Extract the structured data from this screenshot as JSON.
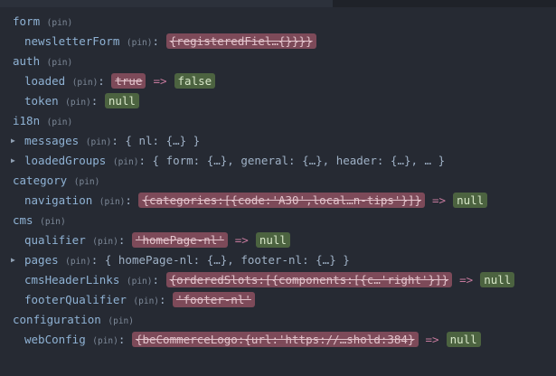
{
  "tree": [
    {
      "type": "section",
      "key": "form",
      "pin": "(pin)"
    },
    {
      "type": "changed",
      "key": "newsletterForm",
      "pin": "(pin)",
      "colon": ":",
      "old": "{registeredFiel…{}}}}"
    },
    {
      "type": "section",
      "key": "auth",
      "pin": "(pin)"
    },
    {
      "type": "changed",
      "key": "loaded",
      "pin": "(pin)",
      "colon": ":",
      "old": "true",
      "arrow": "=>",
      "new": "false"
    },
    {
      "type": "changed",
      "key": "token",
      "pin": "(pin)",
      "colon": ":",
      "new": "null"
    },
    {
      "type": "section",
      "key": "i18n",
      "pin": "(pin)"
    },
    {
      "type": "expandable",
      "key": "messages",
      "pin": "(pin)",
      "colon": ":",
      "value": "{ nl: {…} }"
    },
    {
      "type": "expandable",
      "key": "loadedGroups",
      "pin": "(pin)",
      "colon": ":",
      "value": "{ form: {…}, general: {…}, header: {…}, … }"
    },
    {
      "type": "section",
      "key": "category",
      "pin": "(pin)"
    },
    {
      "type": "changed",
      "key": "navigation",
      "pin": "(pin)",
      "colon": ":",
      "old": "{categories:[{code:'A30',local…n-tips'}]}",
      "arrow": "=>",
      "new": "null"
    },
    {
      "type": "section",
      "key": "cms",
      "pin": "(pin)"
    },
    {
      "type": "changed",
      "key": "qualifier",
      "pin": "(pin)",
      "colon": ":",
      "old": "'homePage-nl'",
      "arrow": "=>",
      "new": "null"
    },
    {
      "type": "expandable",
      "key": "pages",
      "pin": "(pin)",
      "colon": ":",
      "value": "{ homePage-nl: {…}, footer-nl: {…} }"
    },
    {
      "type": "changed",
      "key": "cmsHeaderLinks",
      "pin": "(pin)",
      "colon": ":",
      "old": "{orderedSlots:[{components:[{c…'right'}]}",
      "arrow": "=>",
      "new": "null"
    },
    {
      "type": "changed",
      "key": "footerQualifier",
      "pin": "(pin)",
      "colon": ":",
      "old": "'footer-nl'"
    },
    {
      "type": "section",
      "key": "configuration",
      "pin": "(pin)"
    },
    {
      "type": "changed",
      "key": "webConfig",
      "pin": "(pin)",
      "colon": ":",
      "old": "{beCommerceLogo:{url:'https://…shold:384}",
      "arrow": "=>",
      "new": "null"
    }
  ]
}
